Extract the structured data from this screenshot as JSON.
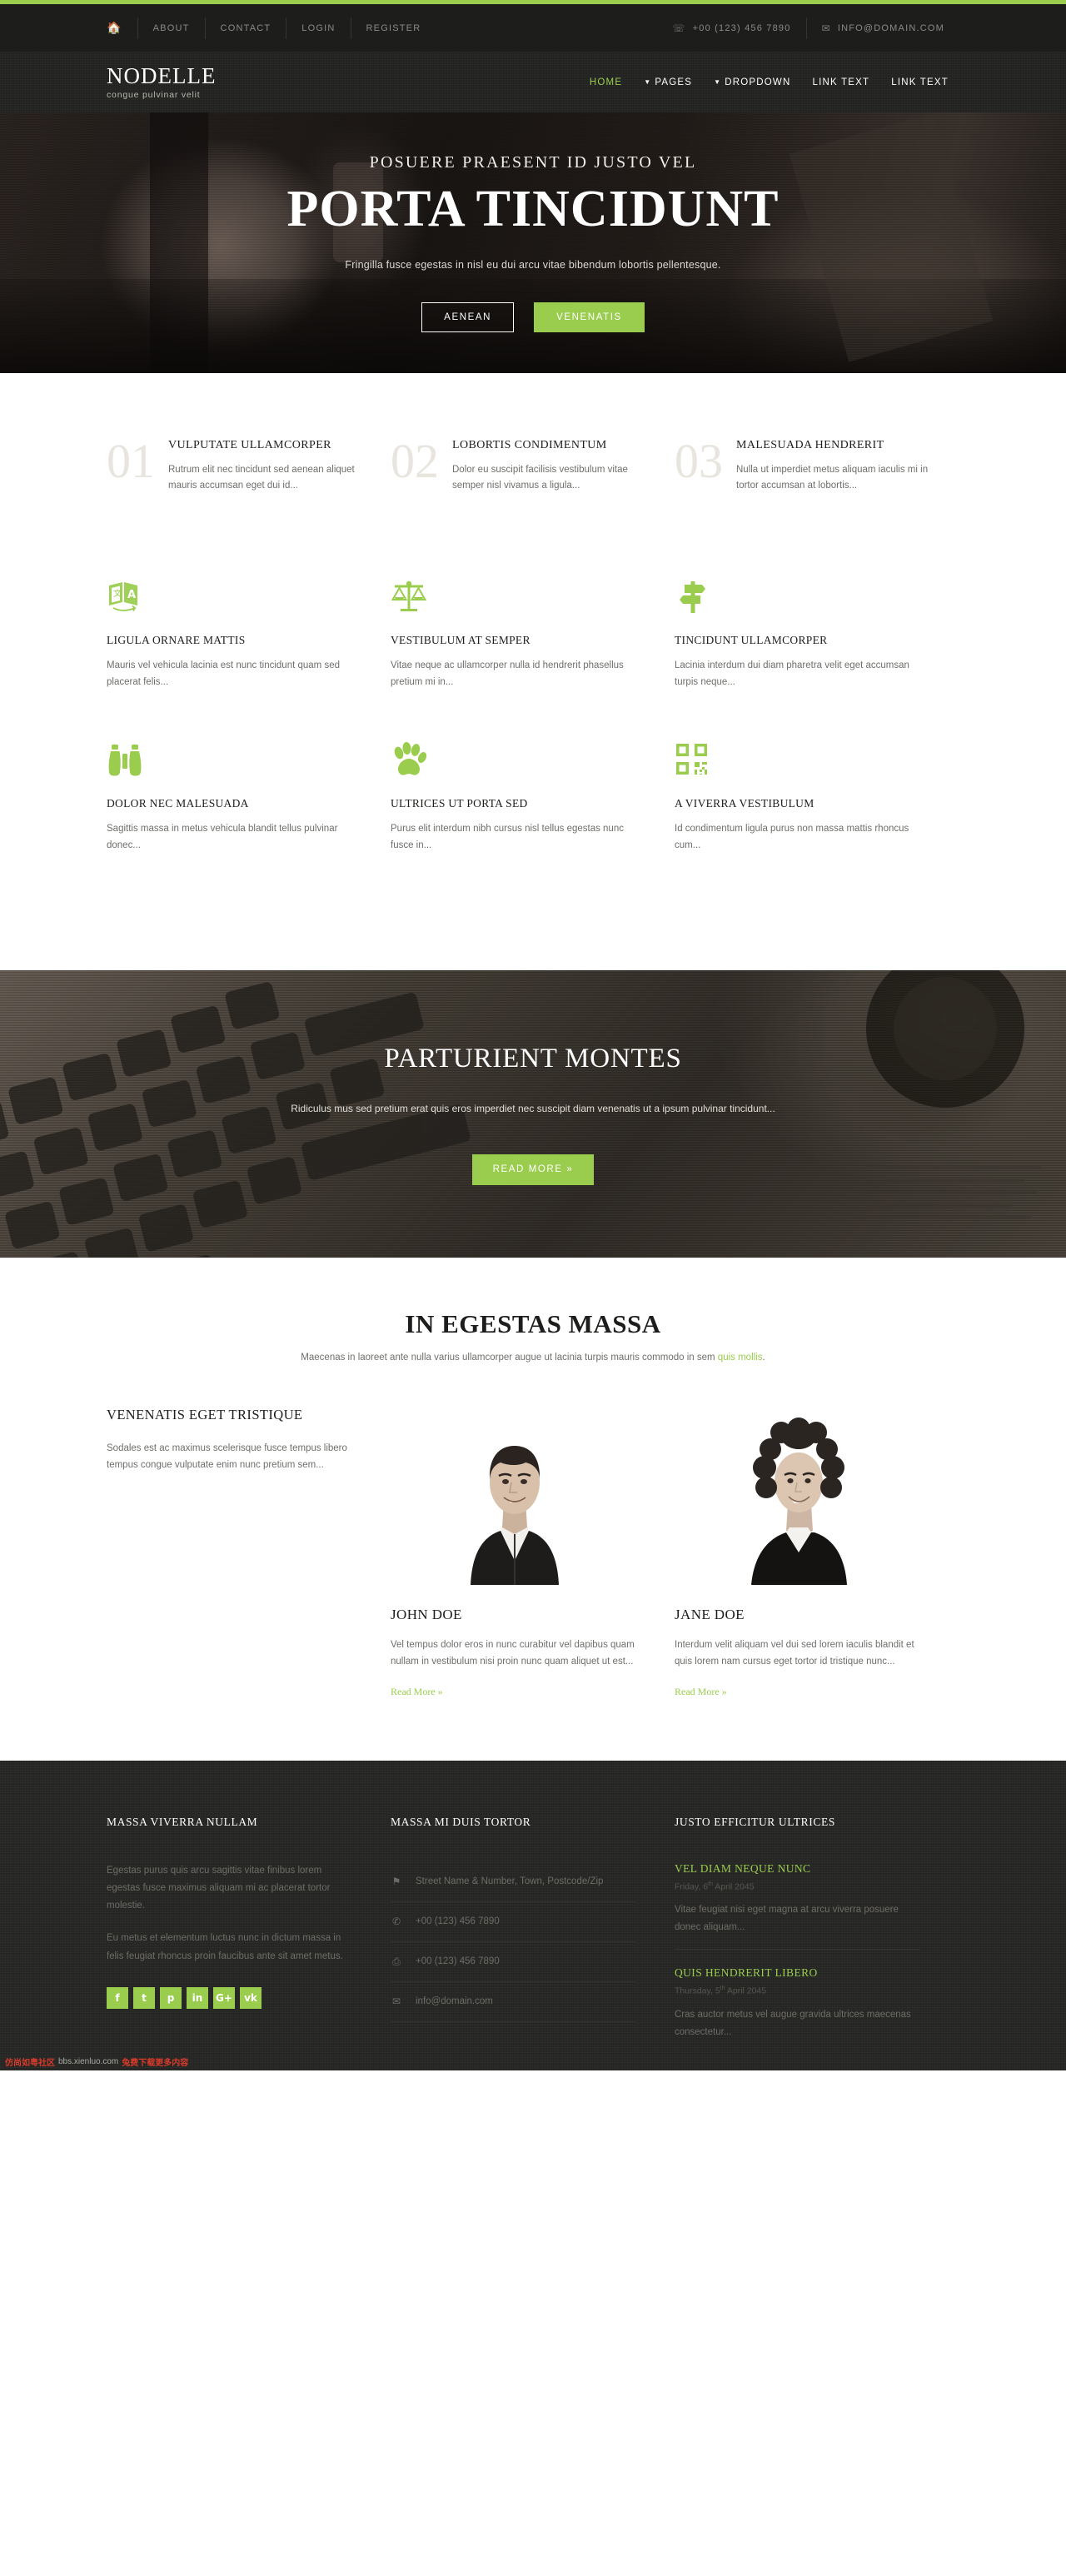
{
  "theme": {
    "accent": "#9ACD4E",
    "dark": "#1d1d1b",
    "darker": "#222220",
    "footer_bg": "#252523"
  },
  "topbar": {
    "home_icon": "home-icon",
    "links": [
      {
        "label": "ABOUT"
      },
      {
        "label": "CONTACT"
      },
      {
        "label": "LOGIN"
      },
      {
        "label": "REGISTER"
      }
    ],
    "phone_icon": "phone-icon",
    "phone": "+00 (123) 456 7890",
    "email_icon": "envelope-icon",
    "email": "INFO@DOMAIN.COM"
  },
  "header": {
    "brand": "NODELLE",
    "tagline": "congue pulvinar velit",
    "nav": [
      {
        "label": "HOME",
        "active": true,
        "caret": false
      },
      {
        "label": "PAGES",
        "active": false,
        "caret": true
      },
      {
        "label": "DROPDOWN",
        "active": false,
        "caret": true
      },
      {
        "label": "LINK TEXT",
        "active": false,
        "caret": false
      },
      {
        "label": "LINK TEXT",
        "active": false,
        "caret": false
      }
    ]
  },
  "hero": {
    "subtitle": "POSUERE PRAESENT ID JUSTO VEL",
    "title": "PORTA TINCIDUNT",
    "description": "Fringilla fusce egestas in nisl eu dui arcu vitae bibendum lobortis pellentesque.",
    "btn_primary": "AENEAN",
    "btn_secondary": "VENENATIS"
  },
  "numbers": [
    {
      "num": "01",
      "title": "VULPUTATE ULLAMCORPER",
      "text": "Rutrum elit nec tincidunt sed aenean aliquet mauris accumsan eget dui id..."
    },
    {
      "num": "02",
      "title": "LOBORTIS CONDIMENTUM",
      "text": "Dolor eu suscipit facilisis vestibulum vitae semper nisl vivamus a ligula..."
    },
    {
      "num": "03",
      "title": "MALESUADA HENDRERIT",
      "text": "Nulla ut imperdiet metus aliquam iaculis mi in tortor accumsan at lobortis..."
    }
  ],
  "services": [
    {
      "icon": "translate-icon",
      "title": "LIGULA ORNARE MATTIS",
      "text": "Mauris vel vehicula lacinia est nunc tincidunt quam sed placerat felis..."
    },
    {
      "icon": "scales-icon",
      "title": "VESTIBULUM AT SEMPER",
      "text": "Vitae neque ac ullamcorper nulla id hendrerit phasellus pretium mi in..."
    },
    {
      "icon": "signpost-icon",
      "title": "TINCIDUNT ULLAMCORPER",
      "text": "Lacinia interdum dui diam pharetra velit eget accumsan turpis neque..."
    },
    {
      "icon": "binoculars-icon",
      "title": "DOLOR NEC MALESUADA",
      "text": "Sagittis massa in metus vehicula blandit tellus pulvinar donec..."
    },
    {
      "icon": "paw-icon",
      "title": "ULTRICES UT PORTA SED",
      "text": "Purus elit interdum nibh cursus nisl tellus egestas nunc fusce in..."
    },
    {
      "icon": "qrcode-icon",
      "title": "A VIVERRA VESTIBULUM",
      "text": "Id condimentum ligula purus non massa mattis rhoncus cum..."
    }
  ],
  "cta": {
    "title": "PARTURIENT MONTES",
    "description": "Ridiculus mus sed pretium erat quis eros imperdiet nec suscipit diam venenatis ut a ipsum pulvinar tincidunt...",
    "button": "READ MORE »"
  },
  "team_section": {
    "title": "IN EGESTAS MASSA",
    "desc_before": "Maecenas in laoreet ante nulla varius ullamcorper augue ut lacinia turpis mauris commodo in sem ",
    "desc_link": "quis mollis",
    "desc_after": ".",
    "left_title": "VENENATIS EGET TRISTIQUE",
    "left_text": "Sodales est ac maximus scelerisque fusce tempus libero tempus congue vulputate enim nunc pretium sem...",
    "members": [
      {
        "name": "JOHN DOE",
        "photo": "male-portrait",
        "text": "Vel tempus dolor eros in nunc curabitur vel dapibus quam nullam in vestibulum nisi proin nunc quam aliquet ut est...",
        "more": "Read More »"
      },
      {
        "name": "JANE DOE",
        "photo": "female-portrait",
        "text": "Interdum velit aliquam vel dui sed lorem iaculis blandit et quis lorem nam cursus eget tortor id tristique nunc...",
        "more": "Read More »"
      }
    ]
  },
  "footer": {
    "col1": {
      "title": "MASSA VIVERRA NULLAM",
      "p1": "Egestas purus quis arcu sagittis vitae finibus lorem egestas fusce maximus aliquam mi ac placerat tortor molestie.",
      "p2": "Eu metus et elementum luctus nunc in dictum massa in felis feugiat rhoncus proin faucibus ante sit amet metus.",
      "socials": [
        {
          "icon": "facebook-icon",
          "glyph": "f"
        },
        {
          "icon": "twitter-icon",
          "glyph": "t"
        },
        {
          "icon": "pinterest-icon",
          "glyph": "p"
        },
        {
          "icon": "linkedin-icon",
          "glyph": "in"
        },
        {
          "icon": "google-plus-icon",
          "glyph": "G+"
        },
        {
          "icon": "vk-icon",
          "glyph": "vk"
        }
      ]
    },
    "col2": {
      "title": "MASSA MI DUIS TORTOR",
      "lines": [
        {
          "icon": "map-marker-icon",
          "glyph": "⚑",
          "text": "Street Name & Number, Town, Postcode/Zip"
        },
        {
          "icon": "phone-icon",
          "glyph": "✆",
          "text": "+00 (123) 456 7890"
        },
        {
          "icon": "fax-icon",
          "glyph": "⎙",
          "text": "+00 (123) 456 7890"
        },
        {
          "icon": "envelope-icon",
          "glyph": "✉",
          "text": "info@domain.com"
        }
      ]
    },
    "col3": {
      "title": "JUSTO EFFICITUR ULTRICES",
      "posts": [
        {
          "title": "VEL DIAM NEQUE NUNC",
          "date_day": "Friday, 6",
          "date_sup": "th",
          "date_rest": " April 2045",
          "text": "Vitae feugiat nisi eget magna at arcu viverra posuere donec aliquam..."
        },
        {
          "title": "QUIS HENDRERIT LIBERO",
          "date_day": "Thursday, 5",
          "date_sup": "th",
          "date_rest": " April 2045",
          "text": "Cras auctor metus vel augue gravida ultrices maecenas consectetur..."
        }
      ]
    }
  },
  "watermark": {
    "red": "仿尚如粤社区",
    "gray": "bbs.xienluo.com",
    "red2": "兔费下载更多内容"
  }
}
